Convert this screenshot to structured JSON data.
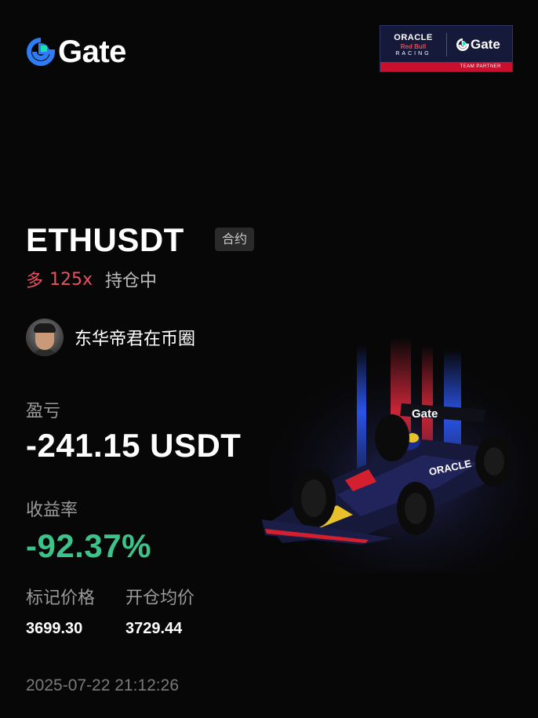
{
  "brand": {
    "name": "Gate",
    "accent": "#2e7cf6",
    "accent2": "#17e0a8"
  },
  "partner_badge": {
    "oracle": "ORACLE",
    "redbull": "Red Bull",
    "racing": "RACING",
    "gate": "Gate",
    "footer": "TEAM PARTNER"
  },
  "trade": {
    "symbol": "ETHUSDT",
    "tag": "合约",
    "direction": "多",
    "leverage": "125x",
    "status": "持仓中"
  },
  "user": {
    "name": "东华帝君在币圈"
  },
  "pnl": {
    "label": "盈亏",
    "value": "-241.15 USDT"
  },
  "roi": {
    "label": "收益率",
    "value": "-92.37%"
  },
  "prices": {
    "mark_label": "标记价格",
    "mark_value": "3699.30",
    "entry_label": "开仓均价",
    "entry_value": "3729.44"
  },
  "timestamp": "2025-07-22 21:12:26",
  "colors": {
    "long": "#e8515e",
    "profit_rate": "#3cc38a",
    "background": "#070707"
  }
}
